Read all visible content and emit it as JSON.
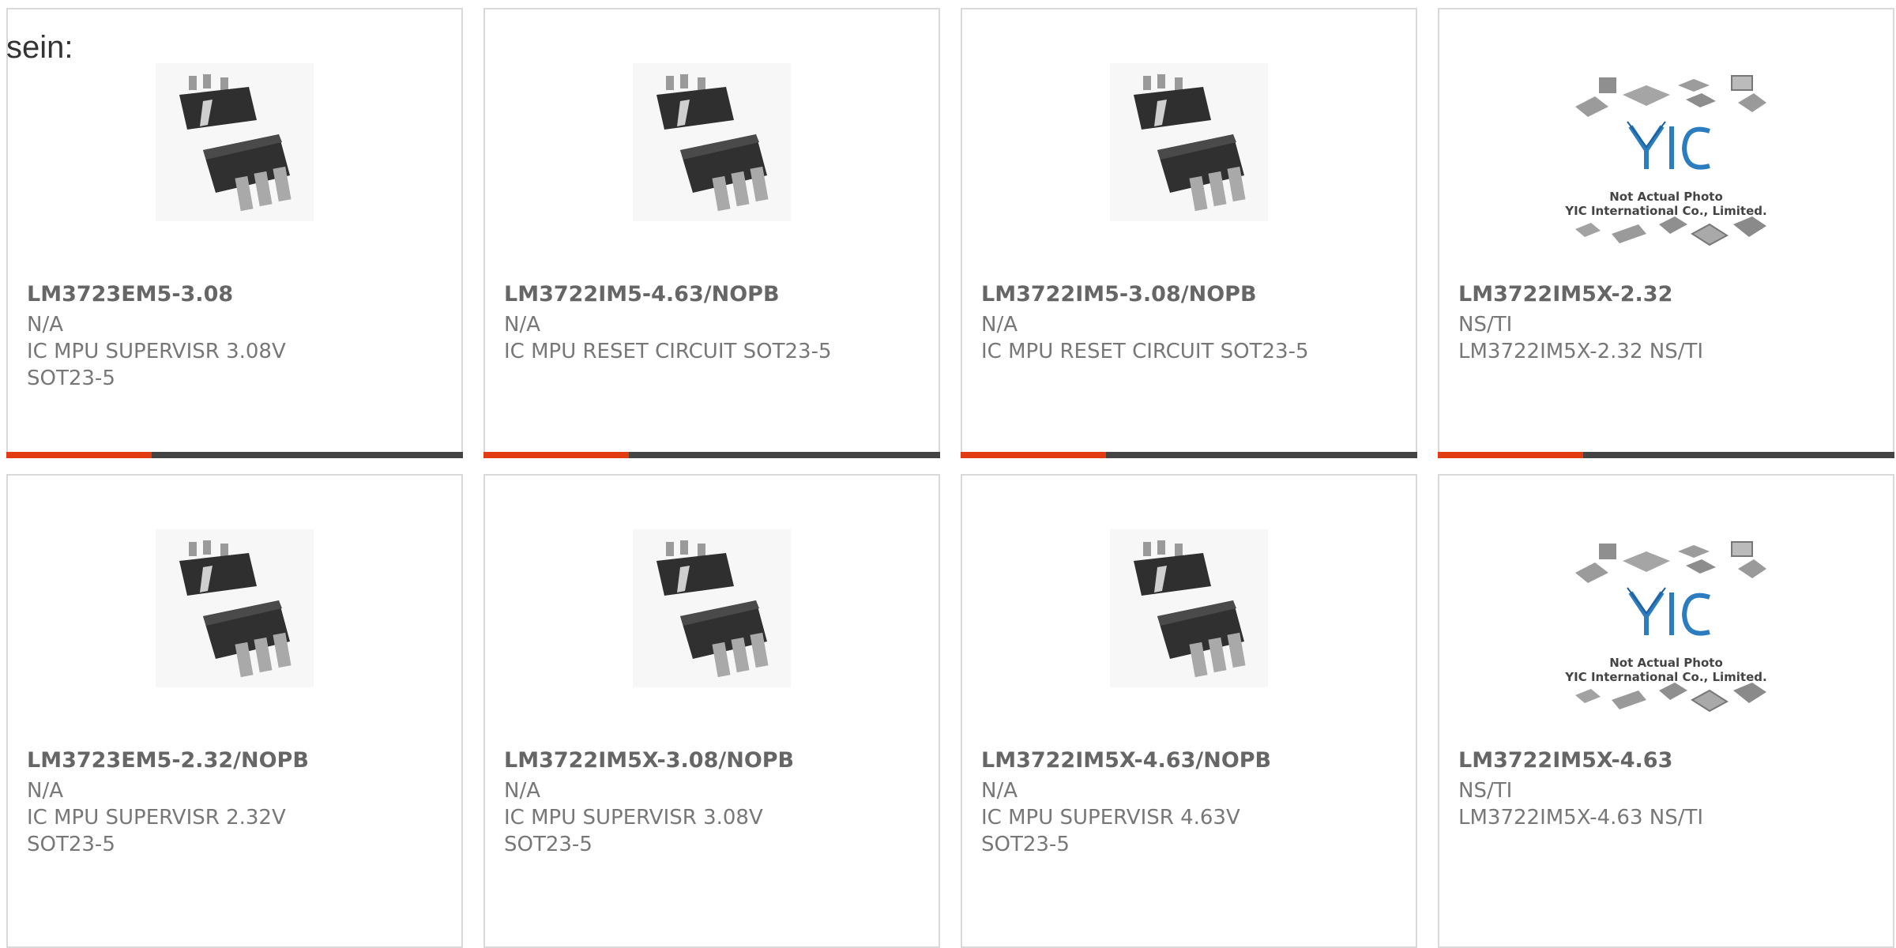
{
  "intro_text": "sein:",
  "colors": {
    "accent_red": "#e23c12",
    "accent_dark": "#444444",
    "border": "#d9d9d9"
  },
  "products": [
    {
      "part": "LM3723EM5-3.08",
      "maker": "N/A",
      "desc": "IC MPU SUPERVISR 3.08V",
      "pkg": "SOT23-5",
      "image": "sot23-chip-icon"
    },
    {
      "part": "LM3722IM5-4.63/NOPB",
      "maker": "N/A",
      "desc": "IC MPU RESET CIRCUIT SOT23-5",
      "pkg": "",
      "image": "sot23-chip-icon"
    },
    {
      "part": "LM3722IM5-3.08/NOPB",
      "maker": "N/A",
      "desc": "IC MPU RESET CIRCUIT SOT23-5",
      "pkg": "",
      "image": "sot23-chip-icon"
    },
    {
      "part": "LM3722IM5X-2.32",
      "maker": "NS/TI",
      "desc": "LM3722IM5X-2.32 NS/TI",
      "pkg": "",
      "image": "not-actual-photo",
      "photo_note": "Not Actual Photo",
      "photo_company": "YIC International Co., Limited.",
      "photo_logo": "YIC"
    },
    {
      "part": "LM3723EM5-2.32/NOPB",
      "maker": "N/A",
      "desc": "IC MPU SUPERVISR 2.32V",
      "pkg": "SOT23-5",
      "image": "sot23-chip-icon"
    },
    {
      "part": "LM3722IM5X-3.08/NOPB",
      "maker": "N/A",
      "desc": "IC MPU SUPERVISR 3.08V",
      "pkg": "SOT23-5",
      "image": "sot23-chip-icon"
    },
    {
      "part": "LM3722IM5X-4.63/NOPB",
      "maker": "N/A",
      "desc": "IC MPU SUPERVISR 4.63V",
      "pkg": "SOT23-5",
      "image": "sot23-chip-icon"
    },
    {
      "part": "LM3722IM5X-4.63",
      "maker": "NS/TI",
      "desc": "LM3722IM5X-4.63 NS/TI",
      "pkg": "",
      "image": "not-actual-photo",
      "photo_note": "Not Actual Photo",
      "photo_company": "YIC International Co., Limited.",
      "photo_logo": "YIC"
    }
  ]
}
